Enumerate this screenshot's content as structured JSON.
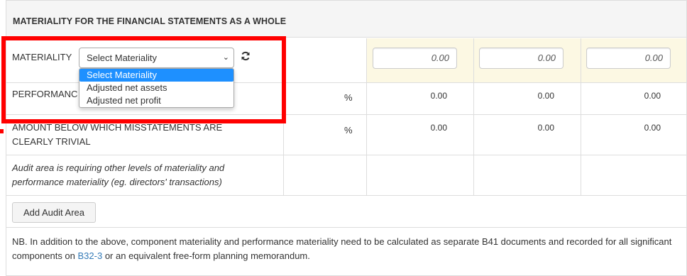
{
  "section": {
    "title": "MATERIALITY FOR THE FINANCIAL STATEMENTS AS A WHOLE"
  },
  "materiality": {
    "label": "MATERIALITY",
    "select_value": "Select Materiality",
    "options": [
      "Select Materiality",
      "Adjusted net assets",
      "Adjusted net profit"
    ],
    "selected_option_index": 0,
    "inputs": [
      "0.00",
      "0.00",
      "0.00"
    ]
  },
  "performance": {
    "label": "PERFORMANC",
    "pct": "%",
    "values": [
      "0.00",
      "0.00",
      "0.00"
    ]
  },
  "trivial": {
    "label_line1": "AMOUNT BELOW WHICH MISSTATEMENTS ARE",
    "label_line2": "CLEARLY TRIVIAL",
    "pct": "%",
    "values": [
      "0.00",
      "0.00",
      "0.00"
    ]
  },
  "audit_area": {
    "label_line1": "Audit area is requiring other levels of materiality and",
    "label_line2": "performance materiality (eg. directors' transactions)"
  },
  "add_button_label": "Add Audit Area",
  "note": {
    "text_before_link": "NB. In addition to the above, component materiality and performance materiality need to be calculated as separate B41 documents and recorded for all significant components on ",
    "link_text": "B32-3",
    "text_after_link": " or an equivalent free-form planning memorandum."
  },
  "colors": {
    "highlight_box": "#ff0000",
    "input_row_shade": "#fcf8e3",
    "selected_option": "#1e90ff",
    "link": "#337ab7"
  },
  "icons": {
    "refresh": "refresh-icon",
    "select_arrow": "chevron-down-icon"
  }
}
